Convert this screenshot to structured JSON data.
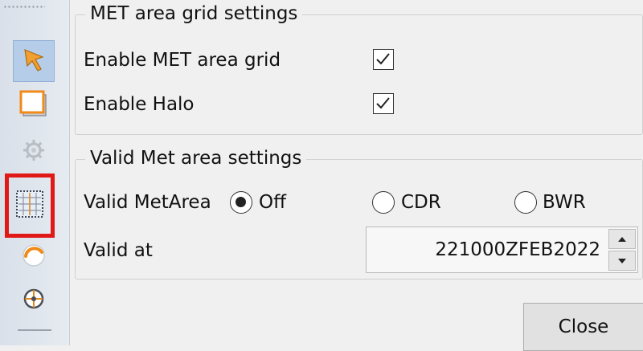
{
  "toolbar": {
    "items": [
      {
        "icon": "pointer-arrow-icon",
        "state": "pressed"
      },
      {
        "icon": "rectangle-icon",
        "state": "normal"
      },
      {
        "icon": "gear-icon",
        "state": "disabled"
      },
      {
        "icon": "grid-icon",
        "state": "highlighted"
      },
      {
        "icon": "arc-icon",
        "state": "normal"
      },
      {
        "icon": "crosshair-icon",
        "state": "normal"
      }
    ]
  },
  "met_grid": {
    "title": "MET area grid settings",
    "enable_grid_label": "Enable MET area grid",
    "enable_grid_checked": true,
    "enable_halo_label": "Enable Halo",
    "enable_halo_checked": true
  },
  "valid_met": {
    "title": "Valid Met area settings",
    "metarea_label": "Valid MetArea",
    "options": [
      {
        "label": "Off",
        "selected": true
      },
      {
        "label": "CDR",
        "selected": false
      },
      {
        "label": "BWR",
        "selected": false
      }
    ],
    "valid_at_label": "Valid at",
    "valid_at_value": "221000ZFEB2022"
  },
  "close_label": "Close",
  "colors": {
    "highlight": "#e01818",
    "pressed": "#b6cde9"
  }
}
